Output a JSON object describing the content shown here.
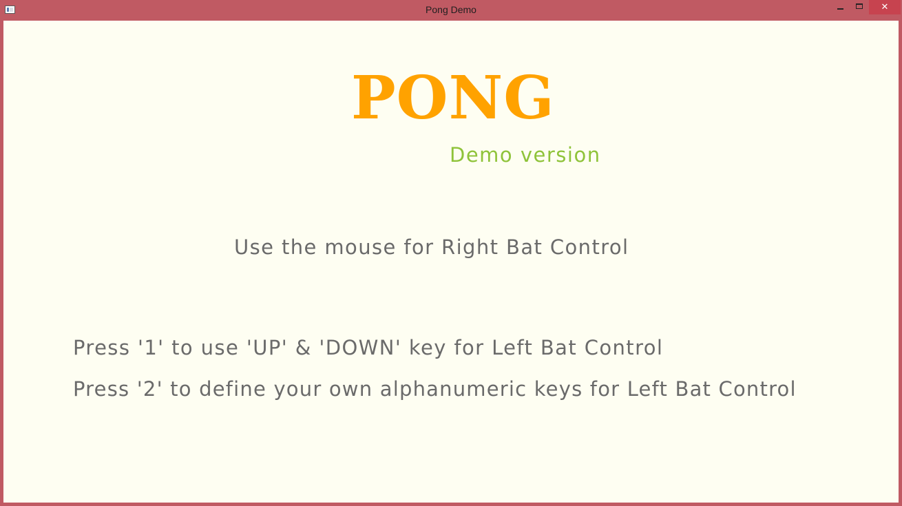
{
  "window": {
    "title": "Pong Demo",
    "controls": {
      "minimize_icon": "minimize-icon",
      "maximize_icon": "maximize-icon",
      "close_icon": "close-icon",
      "close_glyph": "✕"
    },
    "frame_color": "#c05a63"
  },
  "game": {
    "title": "PONG",
    "subtitle": "Demo version",
    "mouse_instruction": "Use the mouse for Right Bat Control",
    "options": [
      "Press '1' to use 'UP' & 'DOWN' key for Left Bat Control",
      "Press '2' to define your own alphanumeric keys for Left Bat Control"
    ],
    "colors": {
      "background": "#fefef2",
      "title": "#ffa200",
      "subtitle": "#8fc33a",
      "text": "#6a6a6a"
    }
  }
}
